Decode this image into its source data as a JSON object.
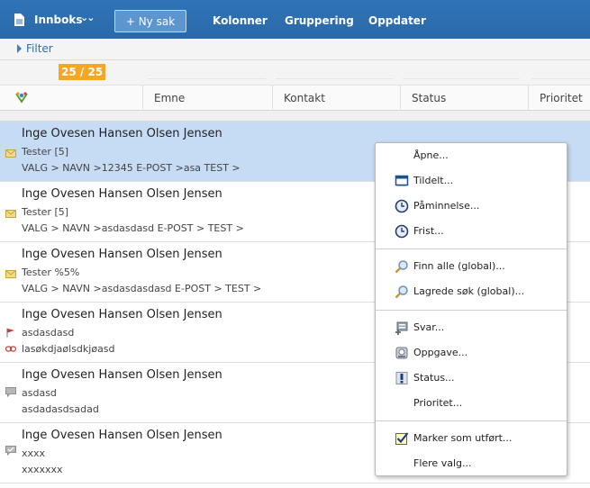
{
  "topbar": {
    "inbox_label": "Innboks",
    "new_case_label": "+ Ny sak",
    "columns_label": "Kolonner",
    "grouping_label": "Gruppering",
    "refresh_label": "Oppdater"
  },
  "filter": {
    "label": "Filter"
  },
  "count": {
    "badge": "25 / 25"
  },
  "columns": [
    "Emne",
    "Kontakt",
    "Status",
    "Prioritet"
  ],
  "rows": [
    {
      "name": "Inge Ovesen Hansen Olsen Jensen",
      "subject": "Tester [5]",
      "path": "VALG > NAVN >12345 E-POST >asa TEST >",
      "icon": "envelope-icon",
      "selected": true
    },
    {
      "name": "Inge Ovesen Hansen Olsen Jensen",
      "subject": "Tester [5]",
      "path": "VALG > NAVN >asdasdasd E-POST > TEST >",
      "icon": "envelope-icon",
      "selected": false
    },
    {
      "name": "Inge Ovesen Hansen Olsen Jensen",
      "subject": "Tester %5%",
      "path": "VALG > NAVN >asdasdasdasd E-POST > TEST >",
      "icon": "envelope-icon",
      "selected": false
    },
    {
      "name": "Inge Ovesen Hansen Olsen Jensen",
      "subject": "asdasdasd",
      "path": "lasøkdjaølsdkjøasd",
      "icon": "flag-icon",
      "selected": false
    },
    {
      "name": "Inge Ovesen Hansen Olsen Jensen",
      "subject": "asdasd",
      "path": "asdadasdsadad",
      "icon": "comment-icon",
      "selected": false
    },
    {
      "name": "Inge Ovesen Hansen Olsen Jensen",
      "subject": "xxxx",
      "path": "xxxxxxx",
      "icon": "comment-check-icon",
      "selected": false
    }
  ],
  "menu": {
    "open": "Åpne...",
    "assigned": "Tildelt...",
    "reminder": "Påminnelse...",
    "deadline": "Frist...",
    "find_all": "Finn alle (global)...",
    "saved_search": "Lagrede søk (global)...",
    "reply": "Svar...",
    "task": "Oppgave...",
    "status": "Status...",
    "priority": "Prioritet...",
    "mark_done": "Marker som utført...",
    "more": "Flere valg..."
  },
  "colors": {
    "topbar": "#2f74b8",
    "selected_row": "#c6dbf4",
    "badge": "#f5a623",
    "link": "#2f6fb4"
  }
}
